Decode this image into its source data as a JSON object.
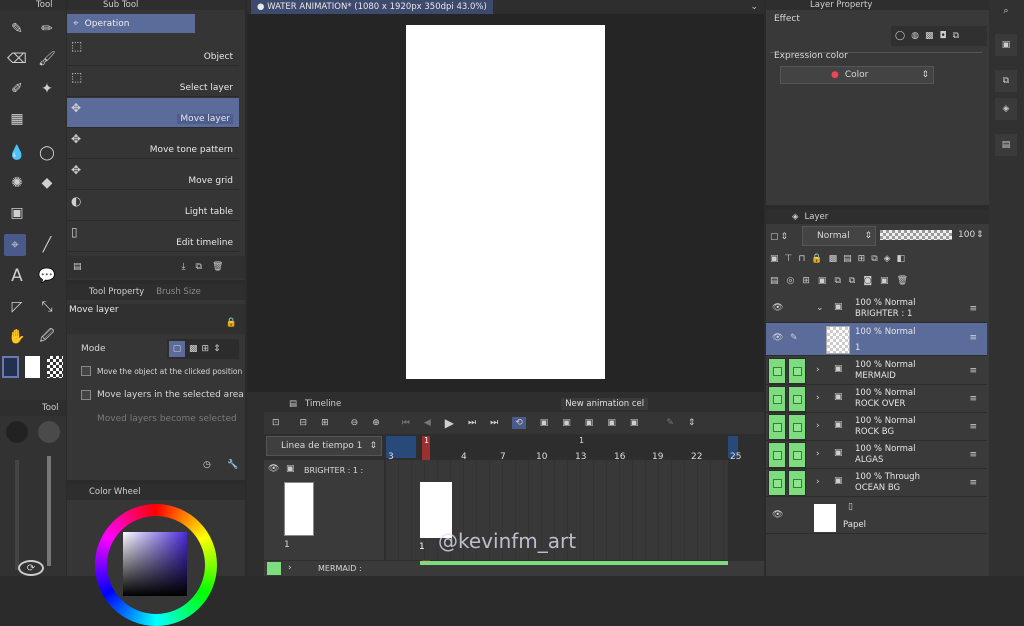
{
  "toolbar": {
    "title": "Tool",
    "sub2": "Tool"
  },
  "subtool": {
    "title": "Sub Tool",
    "header": "Operation",
    "items": [
      "Object",
      "Select layer",
      "Move layer",
      "Move tone pattern",
      "Move grid",
      "Light table",
      "Edit timeline"
    ]
  },
  "toolprop": {
    "tab1": "Tool Property",
    "tab2": "Brush Size",
    "tool_name": "Move layer",
    "mode_label": "Mode",
    "opt1": "Move the object at the clicked position",
    "opt2": "Move layers in the selected area",
    "opt3": "Moved layers become selected"
  },
  "colorwheel": {
    "title": "Color Wheel"
  },
  "canvas": {
    "tab_title": "WATER ANIMATION* (1080 x 1920px 350dpi 43.0%)"
  },
  "layer_property": {
    "title": "Layer Property",
    "effect": "Effect",
    "expr_label": "Expression color",
    "expr_value": "Color"
  },
  "layer_panel": {
    "title": "Layer",
    "blend": "Normal",
    "opacity": "100",
    "layers": [
      {
        "l1": "100 % Normal",
        "l2": "BRIGHTER : 1"
      },
      {
        "l1": "100 % Normal",
        "l2": "1"
      },
      {
        "l1": "100 % Normal",
        "l2": "MERMAID"
      },
      {
        "l1": "100 % Normal",
        "l2": "ROCK OVER"
      },
      {
        "l1": "100 % Normal",
        "l2": "ROCK BG"
      },
      {
        "l1": "100 % Normal",
        "l2": "ALGAS"
      },
      {
        "l1": "100 % Through",
        "l2": "OCEAN BG"
      },
      {
        "l1": "",
        "l2": "Papel"
      }
    ]
  },
  "timeline": {
    "title": "Timeline",
    "tooltip": "New animation cel",
    "timeline_name": "Linea de tiempo 1",
    "track1": "BRIGHTER : 1 :",
    "track2": "MERMAID :",
    "cel_label": "1",
    "playhead": "1",
    "marker": "1",
    "ticks": [
      "3",
      "4",
      "7",
      "10",
      "13",
      "16",
      "19",
      "22",
      "25"
    ],
    "start_frame": "1"
  },
  "watermark": "@kevinfm_art",
  "colors": {
    "accent": "#5b6b9a",
    "green": "#7ddc7d",
    "panel": "#3a3a3a"
  }
}
